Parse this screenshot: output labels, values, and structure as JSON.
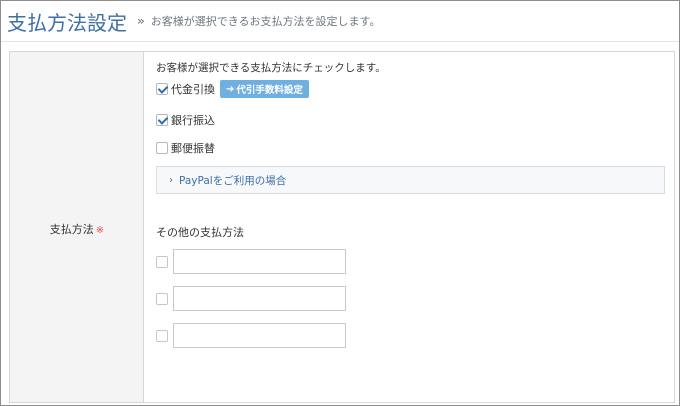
{
  "header": {
    "title": "支払方法設定",
    "separator": "»",
    "description": "お客様が選択できるお支払方法を設定します。"
  },
  "form": {
    "label": "支払方法",
    "required_mark": "※",
    "instruction": "お客様が選択できる支払方法にチェックします。",
    "methods": [
      {
        "label": "代金引換",
        "checked": true
      },
      {
        "label": "銀行振込",
        "checked": true
      },
      {
        "label": "郵便振替",
        "checked": false
      }
    ],
    "fee_button": {
      "icon": "arrow-right-icon",
      "label": "代引手数料設定"
    },
    "paypal": {
      "icon": "chevron-right-icon",
      "label": "PayPalをご利用の場合"
    },
    "other": {
      "title": "その他の支払方法",
      "rows": [
        {
          "checked": false,
          "value": ""
        },
        {
          "checked": false,
          "value": ""
        },
        {
          "checked": false,
          "value": ""
        }
      ]
    }
  }
}
